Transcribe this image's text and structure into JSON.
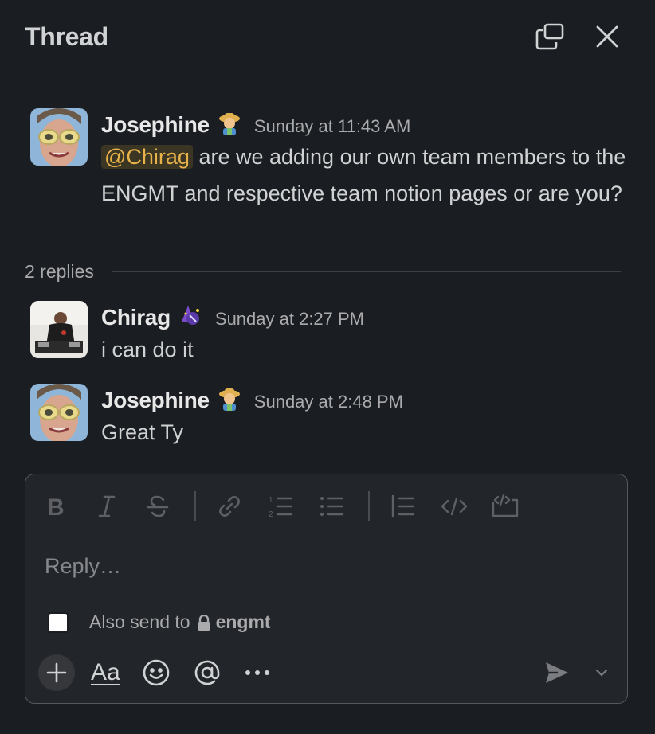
{
  "header": {
    "title": "Thread"
  },
  "messages": [
    {
      "author": "Josephine",
      "time": "Sunday at 11:43 AM",
      "mention": "@Chirag",
      "text": " are we adding our own team members to the ENGMT and respective team notion pages or are you?"
    },
    {
      "author": "Chirag",
      "time": "Sunday at 2:27 PM",
      "text": "i can do it"
    },
    {
      "author": "Josephine",
      "time": "Sunday at 2:48 PM",
      "text": "Great Ty"
    }
  ],
  "thread": {
    "replies_label": "2 replies"
  },
  "composer": {
    "placeholder": "Reply…",
    "also_send_label": "Also send to",
    "channel": "engmt",
    "format_label": "Aa",
    "toolbar_icons": [
      "bold-icon",
      "italic-icon",
      "strikethrough-icon",
      "link-icon",
      "ordered-list-icon",
      "bullet-list-icon",
      "blockquote-icon",
      "code-icon",
      "code-block-icon"
    ]
  },
  "colors": {
    "background": "#1a1d21",
    "mention_bg": "#3b3523",
    "mention_text": "#e8b24a"
  }
}
